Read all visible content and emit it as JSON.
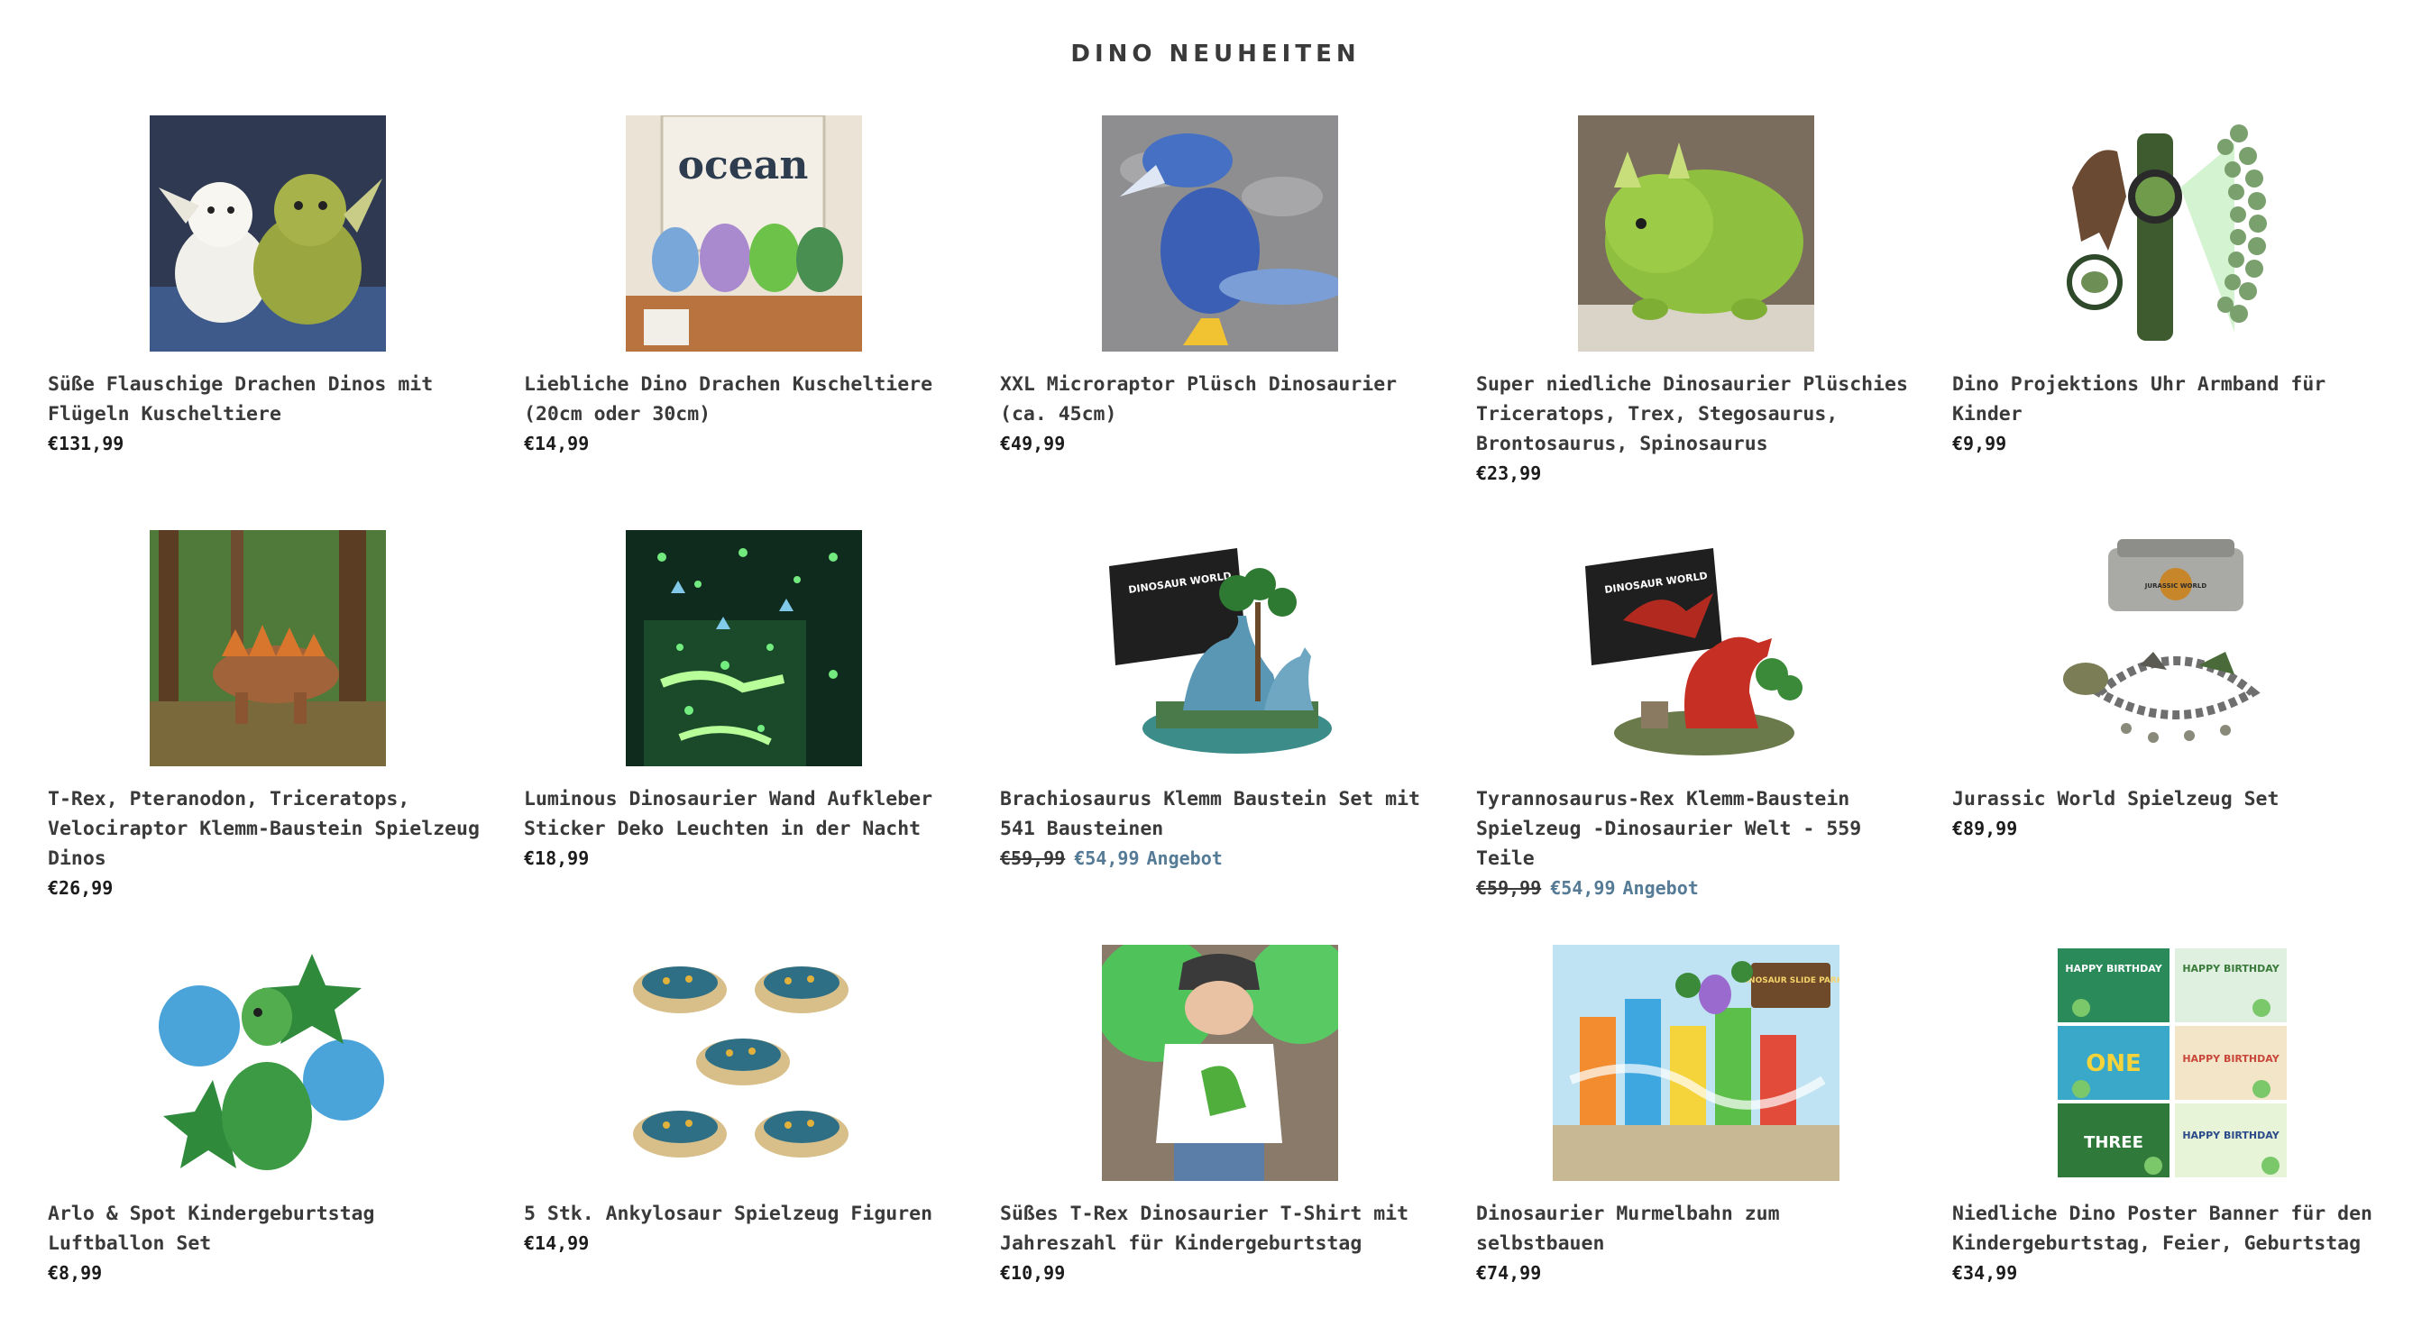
{
  "section": {
    "title": "DINO NEUHEITEN"
  },
  "products": [
    {
      "title": "Süße Flauschige Drachen Dinos mit Flügeln Kuscheltiere",
      "price": "€131,99",
      "image": "plush-dragons-image"
    },
    {
      "title": "Liebliche Dino Drachen Kuscheltiere (20cm oder 30cm)",
      "price": "€14,99",
      "image": "dragon-plush-shelf-image"
    },
    {
      "title": "XXL Microraptor Plüsch Dinosaurier (ca. 45cm)",
      "price": "€49,99",
      "image": "microraptor-plush-image"
    },
    {
      "title": "Super niedliche Dinosaurier Plüschies Triceratops, Trex, Stegosaurus, Brontosaurus, Spinosaurus",
      "price": "€23,99",
      "image": "triceratops-plush-image"
    },
    {
      "title": "Dino Projektions Uhr Armband für Kinder",
      "price": "€9,99",
      "image": "projection-watch-image"
    },
    {
      "title": "T-Rex, Pteranodon, Triceratops, Velociraptor Klemm-Baustein Spielzeug Dinos",
      "price": "€26,99",
      "image": "brick-dino-forest-image"
    },
    {
      "title": "Luminous Dinosaurier Wand Aufkleber Sticker Deko Leuchten in der Nacht",
      "price": "€18,99",
      "image": "glow-stickers-image"
    },
    {
      "title": "Brachiosaurus Klemm Baustein Set mit 541 Bausteinen",
      "old_price": "€59,99",
      "sale_price": "€54,99",
      "sale_label": "Angebot",
      "image": "brachiosaurus-set-image"
    },
    {
      "title": "Tyrannosaurus-Rex Klemm-Baustein Spielzeug -Dinosaurier Welt - 559 Teile",
      "old_price": "€59,99",
      "sale_price": "€54,99",
      "sale_label": "Angebot",
      "image": "trex-set-image"
    },
    {
      "title": "Jurassic World Spielzeug Set",
      "price": "€89,99",
      "image": "jurassic-world-set-image"
    },
    {
      "title": "Arlo & Spot Kindergeburtstag Luftballon Set",
      "price": "€8,99",
      "image": "balloon-set-image"
    },
    {
      "title": "5 Stk. Ankylosaur Spielzeug Figuren",
      "price": "€14,99",
      "image": "ankylosaur-figures-image"
    },
    {
      "title": "Süßes T-Rex Dinosaurier T-Shirt mit Jahreszahl für Kindergeburtstag",
      "price": "€10,99",
      "image": "trex-shirt-image"
    },
    {
      "title": "Dinosaurier Murmelbahn zum selbstbauen",
      "price": "€74,99",
      "image": "marble-run-image"
    },
    {
      "title": "Niedliche Dino Poster Banner für den Kindergeburtstag, Feier, Geburtstag",
      "price": "€34,99",
      "image": "birthday-banner-image"
    }
  ],
  "image_labels": {
    "ocean_sign": "ocean",
    "box_brand": "DINOSAUR WORLD",
    "jw_logo": "JURASSIC WORLD",
    "slide_park": "DINOSAUR SLIDE PARK",
    "happy_birthday": "HAPPY BIRTHDAY",
    "one": "ONE",
    "three": "THREE"
  },
  "colors": {
    "text": "#3a3a3a",
    "price": "#1c1c1c",
    "sale": "#557b97"
  }
}
